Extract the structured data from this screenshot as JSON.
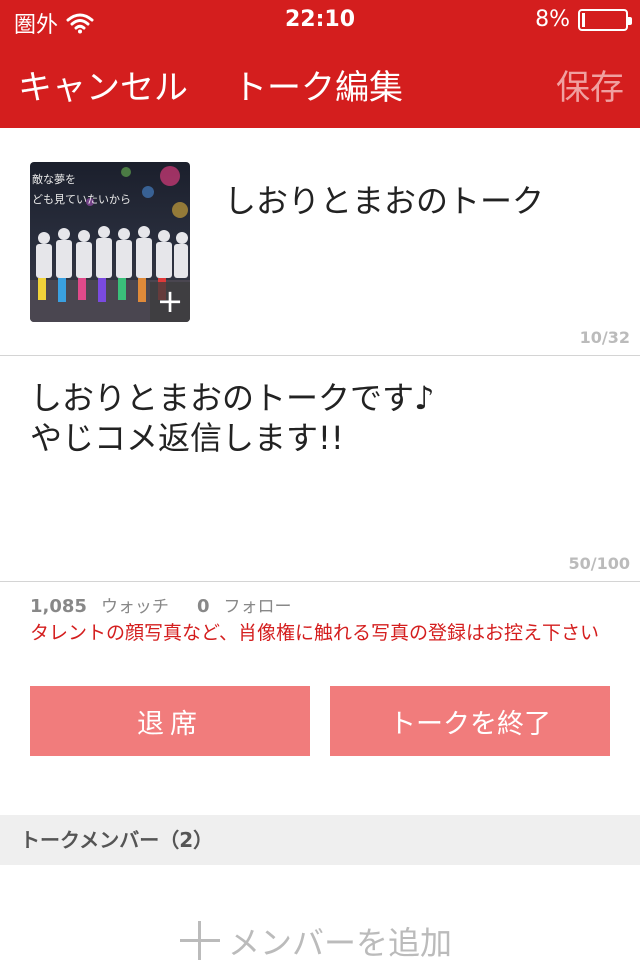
{
  "status_bar": {
    "carrier": "圏外",
    "wifi_icon": "wifi-icon",
    "time": "22:10",
    "battery_text": "8%",
    "battery_level": 0.08
  },
  "nav": {
    "cancel_label": "キャンセル",
    "title": "トーク編集",
    "save_label": "保存"
  },
  "talk": {
    "thumbnail_caption": "敵な夢を\nども見ていたいから",
    "thumbnail_add_icon": "plus-icon",
    "name": "しおりとまおのトーク",
    "name_count": "10/32",
    "description_line1": "しおりとまおのトークです♪",
    "description_line2": "やじコメ返信します!!",
    "description_count": "50/100"
  },
  "stats": {
    "watch_count": "1,085",
    "watch_label": "ウォッチ",
    "follow_count": "0",
    "follow_label": "フォロー"
  },
  "warning": "タレントの顔写真など、肖像権に触れる写真の登録はお控え下さい",
  "buttons": {
    "leave_label": "退席",
    "end_label": "トークを終了"
  },
  "members": {
    "header": "トークメンバー（2）",
    "add_label": "メンバーを追加"
  },
  "colors": {
    "brand_red": "#d41e1e",
    "button_pink": "#f17c7c",
    "save_disabled": "#f0a0a0",
    "counter_gray": "#bbbbbb",
    "section_gray": "#efefef"
  }
}
